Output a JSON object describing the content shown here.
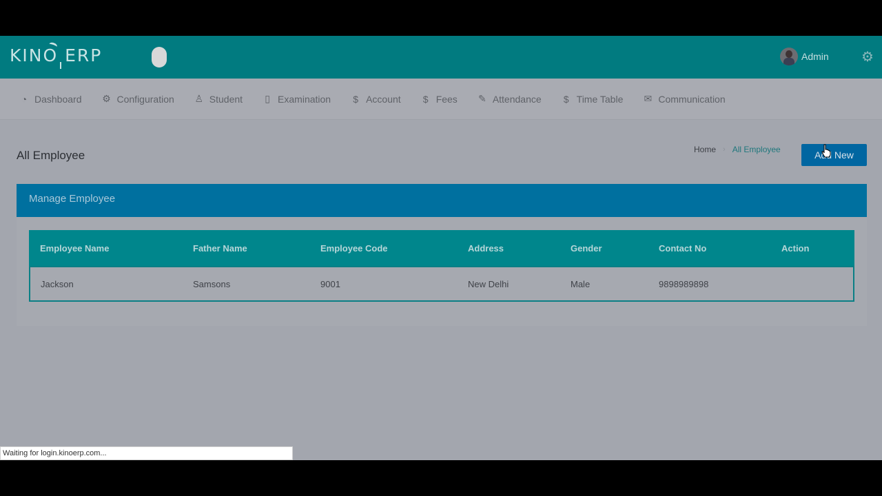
{
  "app": {
    "logo_text": "KINO ERP"
  },
  "header": {
    "user_name": "Admin"
  },
  "nav": {
    "items": [
      {
        "label": "Dashboard",
        "icon": "dashboard-icon"
      },
      {
        "label": "Configuration",
        "icon": "gear-icon"
      },
      {
        "label": "Student",
        "icon": "user-icon"
      },
      {
        "label": "Examination",
        "icon": "clipboard-icon"
      },
      {
        "label": "Account",
        "icon": "dollar-icon"
      },
      {
        "label": "Fees",
        "icon": "dollar-icon"
      },
      {
        "label": "Attendance",
        "icon": "edit-icon"
      },
      {
        "label": "Time Table",
        "icon": "dollar-icon"
      },
      {
        "label": "Communication",
        "icon": "envelope-icon"
      }
    ]
  },
  "page": {
    "title": "All Employee",
    "breadcrumb": {
      "home": "Home",
      "current": "All Employee"
    },
    "add_button": "Add New"
  },
  "card": {
    "title": "Manage Employee"
  },
  "table": {
    "columns": [
      "Employee Name",
      "Father Name",
      "Employee Code",
      "Address",
      "Gender",
      "Contact No",
      "Action"
    ],
    "rows": [
      [
        "Jackson",
        "Samsons",
        "9001",
        "New Delhi",
        "Male",
        "9898989898",
        ""
      ]
    ]
  },
  "status_bar": {
    "text": "Waiting for login.kinoerp.com..."
  },
  "colors": {
    "topbar": "#017b80",
    "card_header": "#00709f",
    "table_header": "#00868c",
    "button": "#0066a1"
  }
}
